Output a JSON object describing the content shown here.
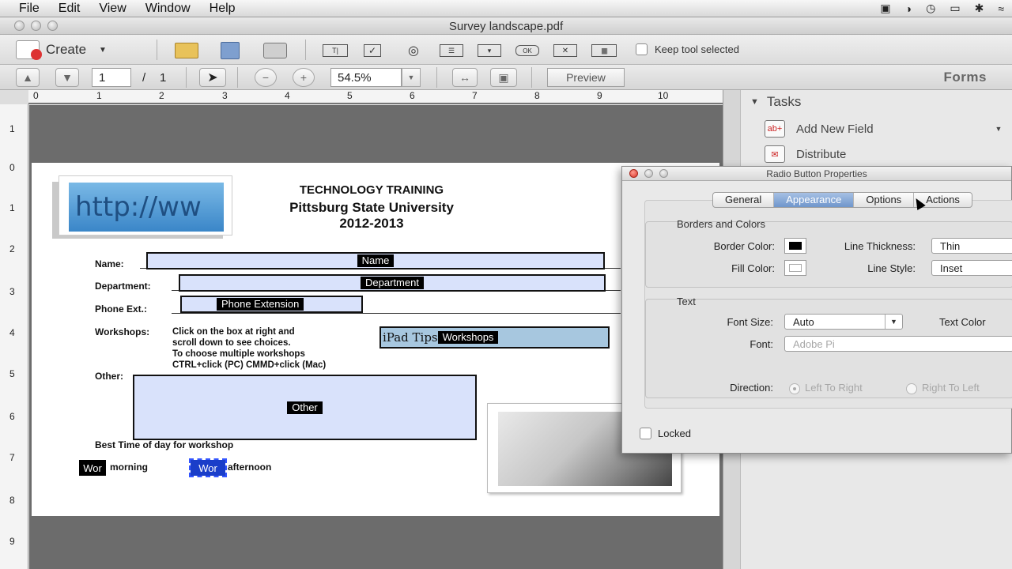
{
  "menubar": {
    "items": [
      "File",
      "Edit",
      "View",
      "Window",
      "Help"
    ],
    "status_icons": [
      "camera-icon",
      "moon-icon",
      "time-machine-icon",
      "display-icon",
      "bluetooth-icon",
      "wifi-icon"
    ]
  },
  "window": {
    "title": "Survey landscape.pdf"
  },
  "toolbar1": {
    "create_label": "Create",
    "keep_tool_label": "Keep tool selected"
  },
  "toolbar2": {
    "page_current": "1",
    "page_sep": "/",
    "page_total": "1",
    "zoom": "54.5%",
    "preview_label": "Preview",
    "forms_label": "Forms"
  },
  "rulers": {
    "top": [
      "0",
      "1",
      "2",
      "3",
      "4",
      "5",
      "6",
      "7",
      "8",
      "9",
      "10"
    ],
    "left": [
      "1",
      "0",
      "1",
      "2",
      "3",
      "4",
      "5",
      "6",
      "7",
      "8",
      "9"
    ]
  },
  "document": {
    "heading1": "TECHNOLOGY TRAINING",
    "heading2": "Pittsburg State University",
    "heading3": "2012-2013",
    "logo_text": "http://ww",
    "name_label": "Name:",
    "name_tag": "Name",
    "dept_label": "Department:",
    "dept_tag": "Department",
    "phone_label": "Phone Ext.:",
    "phone_tag": "Phone Extension",
    "workshops_label": "Workshops:",
    "workshops_note": [
      "Click on the box at right and",
      "scroll down to see choices.",
      "To choose multiple workshops",
      "CTRL+click (PC) CMMD+click (Mac)"
    ],
    "ipad_text": "iPad Tips",
    "workshops_tag": "Workshops",
    "other_label": "Other:",
    "other_tag": "Other",
    "best_time_label": "Best Time of day for workshop",
    "radio1_tag": "Wor",
    "radio1_label": "morning",
    "radio2_tag": "Wor",
    "radio2_label": "afternoon"
  },
  "tasks_panel": {
    "header": "Tasks",
    "items": [
      {
        "label": "Add New Field",
        "icon": "add-field-icon"
      },
      {
        "label": "Distribute",
        "icon": "distribute-icon"
      }
    ]
  },
  "dialog": {
    "title": "Radio Button Properties",
    "tabs": [
      "General",
      "Appearance",
      "Options",
      "Actions"
    ],
    "active_tab": "Appearance",
    "borders_colors_title": "Borders and Colors",
    "border_color_label": "Border Color:",
    "border_color": "#000000",
    "line_thickness_label": "Line Thickness:",
    "line_thickness": "Thin",
    "fill_color_label": "Fill Color:",
    "fill_color": "#ffffff",
    "line_style_label": "Line Style:",
    "line_style": "Inset",
    "text_title": "Text",
    "font_size_label": "Font Size:",
    "font_size": "Auto",
    "text_color_label": "Text Color",
    "font_label": "Font:",
    "font_value": "Adobe Pi",
    "direction_label": "Direction:",
    "direction_ltr": "Left To Right",
    "direction_rtl": "Right To Left",
    "locked_label": "Locked"
  }
}
